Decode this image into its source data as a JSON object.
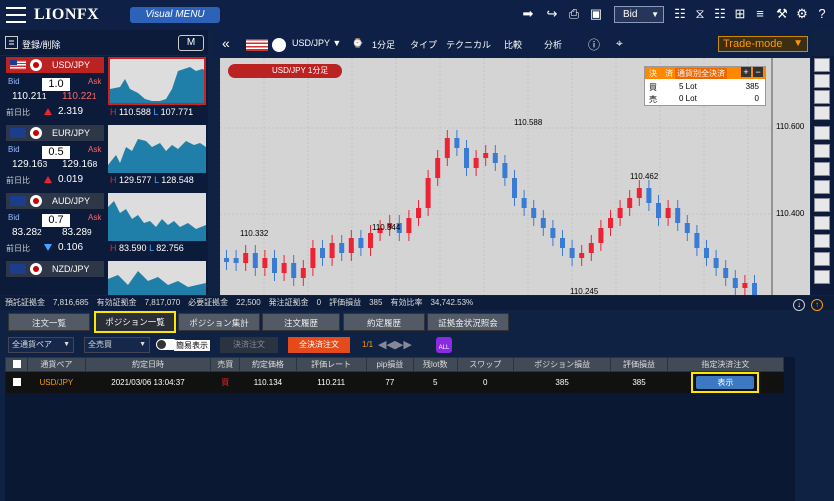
{
  "app": {
    "logo": "LIONFX",
    "visual_menu": "Visual MENU"
  },
  "topbar": {
    "price_mode": "Bid"
  },
  "left_panel": {
    "header_label": "登録/削除",
    "mode_button": "M",
    "cards": [
      {
        "pair": "USD/JPY",
        "bid": "110.21",
        "bid_sub": "1",
        "ask": "110.22",
        "ask_sub": "1",
        "spread": "1.0",
        "prev_label": "前日比",
        "change": "2.319",
        "dir": "up",
        "high": "110.588",
        "low": "107.771",
        "selected": true
      },
      {
        "pair": "EUR/JPY",
        "bid": "129.16",
        "bid_sub": "3",
        "ask": "129.16",
        "ask_sub": "8",
        "spread": "0.5",
        "prev_label": "前日比",
        "change": "0.019",
        "dir": "up",
        "high": "129.577",
        "low": "128.548"
      },
      {
        "pair": "AUD/JPY",
        "bid": "83.28",
        "bid_sub": "2",
        "ask": "83.28",
        "ask_sub": "9",
        "spread": "0.7",
        "prev_label": "前日比",
        "change": "0.106",
        "dir": "down",
        "high": "83.590",
        "low": "82.756"
      },
      {
        "pair": "NZD/JPY"
      }
    ],
    "labels": {
      "bid": "Bid",
      "ask": "Ask",
      "high_prefix": "H",
      "low_prefix": "L"
    }
  },
  "chart_toolbar": {
    "pair": "USD/JPY",
    "timeframe": "1分足",
    "type": "タイプ",
    "technical": "テクニカル",
    "compare": "比較",
    "analysis": "分析",
    "trade_mode": "Trade-mode",
    "count": "4"
  },
  "chart": {
    "symbol_label": "USD/JPY 1分足",
    "settle_panel": {
      "settle_label": "決　済",
      "currency_settle": "通貨別全決済",
      "buy": "買",
      "sell": "売",
      "buy_lot": "5 Lot",
      "sell_lot": "0 Lot",
      "buy_pl": "385",
      "sell_pl": "0"
    },
    "price_labels": [
      "110.588",
      "110.462",
      "110.344",
      "110.332",
      "110.245"
    ],
    "axis_labels": [
      "110.600",
      "110.400"
    ]
  },
  "status_line": {
    "text": "預託証拠金　7,816,685　有効証拠金　7,817,070　必要証拠金　22,500　発注証拠金　0　評価損益　385　有効比率　34,742.53%"
  },
  "tabs": [
    "注文一覧",
    "ポジション一覧",
    "ポジション集計",
    "注文履歴",
    "約定履歴",
    "証拠金状況照会"
  ],
  "filters": {
    "currency": "全通貨ペア",
    "side": "全売買",
    "simple": "簡易表示",
    "settle_order": "決済注文",
    "settle_all": "全決済注文",
    "page": "1/1"
  },
  "table": {
    "headers": [
      "通貨ペア",
      "約定日時",
      "売買",
      "約定価格",
      "評価レート",
      "pip損益",
      "残lot数",
      "スワップ",
      "ポジション損益",
      "評価損益",
      "指定決済注文"
    ],
    "rows": [
      {
        "pair": "USD/JPY",
        "datetime": "2021/03/06 13:04:37",
        "side": "買",
        "price": "110.134",
        "rate": "110.211",
        "pip": "77",
        "lots": "5",
        "swap": "0",
        "pos_pl": "385",
        "eval_pl": "385",
        "action": "表示"
      }
    ]
  },
  "colors": {
    "up": "#e23",
    "down": "#4aa3ff",
    "highlight": "#ffe600"
  }
}
